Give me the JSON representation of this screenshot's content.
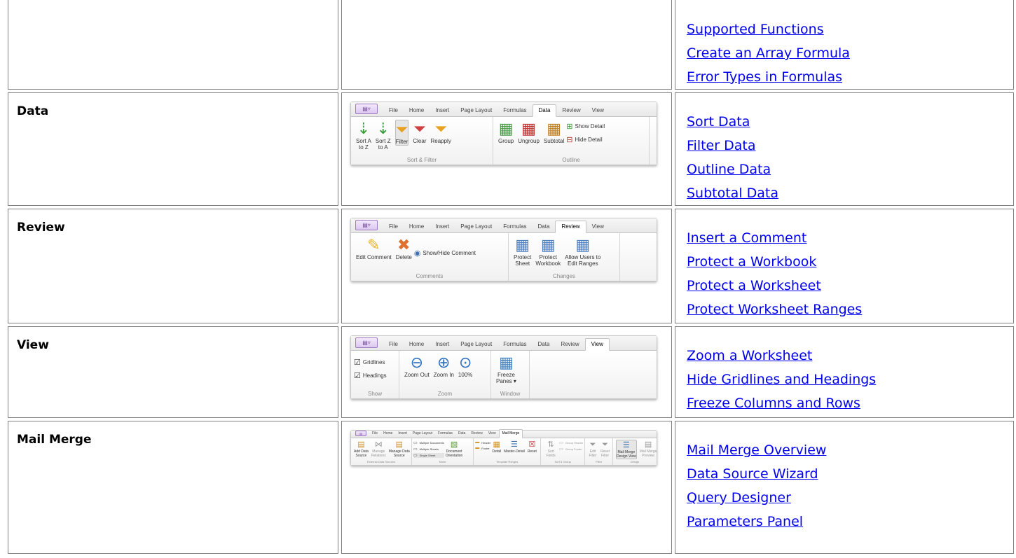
{
  "rows": [
    {
      "feature": "",
      "links": [
        "Supported Functions",
        "Create an Array Formula",
        "Error Types in Formulas"
      ]
    },
    {
      "feature": "Data",
      "links": [
        "Sort Data",
        "Filter Data",
        "Outline Data",
        "Subtotal Data"
      ],
      "ribbon": {
        "tabs": [
          "File",
          "Home",
          "Insert",
          "Page Layout",
          "Formulas",
          "Data",
          "Review",
          "View"
        ],
        "active_tab": "Data",
        "sort_az": "Sort A\nto Z",
        "sort_za": "Sort Z\nto A",
        "filter": "Filter",
        "clear": "Clear",
        "reapply": "Reapply",
        "group_sort_filter": "Sort & Filter",
        "group": "Group",
        "ungroup": "Ungroup",
        "subtotal": "Subtotal",
        "show_detail": "Show Detail",
        "hide_detail": "Hide Detail",
        "group_outline": "Outline"
      }
    },
    {
      "feature": "Review",
      "links": [
        "Insert a Comment",
        "Protect a Workbook",
        "Protect a Worksheet",
        "Protect Worksheet Ranges"
      ],
      "ribbon": {
        "tabs": [
          "File",
          "Home",
          "Insert",
          "Page Layout",
          "Formulas",
          "Data",
          "Review",
          "View"
        ],
        "active_tab": "Review",
        "edit_comment": "Edit Comment",
        "delete": "Delete",
        "show_hide": "Show/Hide Comment",
        "group_comments": "Comments",
        "protect_sheet": "Protect\nSheet",
        "protect_workbook": "Protect\nWorkbook",
        "allow_users": "Allow Users to\nEdit Ranges",
        "group_changes": "Changes"
      }
    },
    {
      "feature": "View",
      "links": [
        "Zoom a Worksheet",
        "Hide Gridlines and Headings",
        "Freeze Columns and Rows"
      ],
      "ribbon": {
        "tabs": [
          "File",
          "Home",
          "Insert",
          "Page Layout",
          "Formulas",
          "Data",
          "Review",
          "View"
        ],
        "active_tab": "View",
        "gridlines": "Gridlines",
        "headings": "Headings",
        "group_show": "Show",
        "zoom_out": "Zoom Out",
        "zoom_in": "Zoom In",
        "zoom_100": "100%",
        "group_zoom": "Zoom",
        "freeze_panes": "Freeze\nPanes ▾",
        "group_window": "Window"
      }
    },
    {
      "feature": "Mail Merge",
      "links": [
        "Mail Merge Overview",
        "Data Source Wizard",
        "Query Designer",
        "Parameters Panel"
      ],
      "ribbon": {
        "tabs": [
          "File",
          "Home",
          "Insert",
          "Page Layout",
          "Formulas",
          "Data",
          "Review",
          "View",
          "Mail Merge"
        ],
        "active_tab": "Mail Merge",
        "add_data_source": "Add Data\nSource",
        "manage_relations": "Manage\nRelations",
        "manage_data_source": "Manage Data\nSource",
        "group_external": "External Data Sources",
        "multiple_documents": "Multiple Documents",
        "multiple_sheets": "Multiple Sheets",
        "single_sheet": "Single Sheet",
        "document_orientation": "Document\nOrientation",
        "group_mode": "Mode",
        "header": "Header",
        "footer": "Footer",
        "detail": "Detail",
        "master_detail": "Master-Detail",
        "reset": "Reset",
        "group_template": "Template Ranges",
        "sort_fields": "Sort Fields",
        "group_header": "Group Header",
        "group_footer": "Group Footer",
        "group_sort_group": "Sort & Group",
        "edit_filter": "Edit Filter",
        "reset_filter": "Reset\nFilter",
        "group_filter": "Filter",
        "mail_merge_design_view": "Mail Merge\nDesign View",
        "mail_merge_preview": "Mail Merge\nPreview",
        "group_design": "Design"
      }
    }
  ]
}
